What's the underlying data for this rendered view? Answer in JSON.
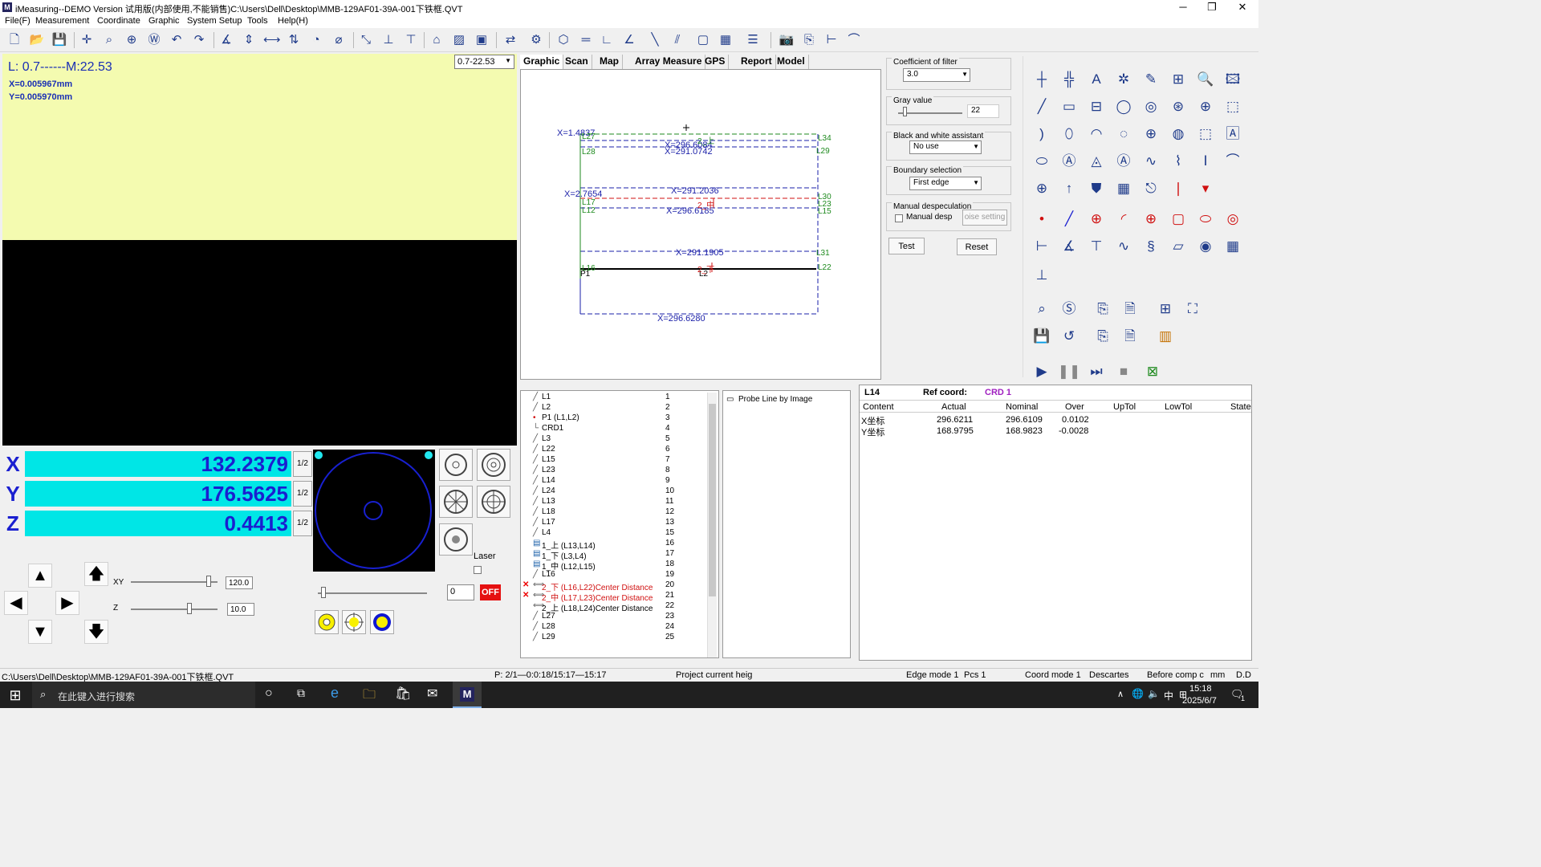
{
  "app": {
    "title": "iMeasuring--DEMO  Version  试用版(内部使用,不能销售)C:\\Users\\Dell\\Desktop\\MMB-129AF01-39A-001下铁框.QVT",
    "icon_letter": "M"
  },
  "menu": [
    "File(F)",
    "Measurement",
    "Coordinate",
    "Graphic",
    "System Setup",
    "Tools",
    "Help(H)"
  ],
  "camera": {
    "lm": "L: 0.7------M:22.53",
    "x": "X=0.005967mm",
    "y": "Y=0.005970mm",
    "zoom": "0.7-22.53"
  },
  "dro": {
    "x": {
      "axis": "X",
      "value": "132.2379",
      "half": "1/2"
    },
    "y": {
      "axis": "Y",
      "value": "176.5625",
      "half": "1/2"
    },
    "z": {
      "axis": "Z",
      "value": "0.4413",
      "half": "1/2"
    }
  },
  "jog": {
    "xy_label": "XY",
    "z_label": "Z",
    "xy_speed": "120.0",
    "z_speed": "10.0",
    "xy_level": 0.9,
    "z_level": 0.68
  },
  "lighting": {
    "laser_label": "Laser",
    "light_value": "0",
    "off_label": "OFF"
  },
  "tabs": [
    "Graphic",
    "Scan",
    "Map",
    "Array Measure",
    "GPS",
    "Report",
    "Model"
  ],
  "graphic": {
    "labels": {
      "x1": "X=1.4837",
      "x2": "X=296.6084",
      "x3": "X=291.0742",
      "x4": "X=2.7654",
      "x5": "X=291.2036",
      "x6": "X=296.6185",
      "x7": "X=291.1905",
      "x8": "X=296.6280",
      "l27": "L27",
      "l28": "L28",
      "l34": "L34",
      "l29": "L29",
      "l17": "L17",
      "l12": "L12",
      "l30": "L30",
      "l23": "L23",
      "l15": "L15",
      "l31": "L31",
      "l16": "L16",
      "p1": "P1",
      "l22": "L22",
      "l2": "L2",
      "m1": "2_上",
      "m2": "2_中",
      "m3": "2_下"
    }
  },
  "filters": {
    "coef_label": "Coefficient of filter",
    "coef_value": "3.0",
    "gray_label": "Gray value",
    "gray_value": "22",
    "bw_label": "Black and white assistant",
    "bw_value": "No use",
    "boundary_label": "Boundary selection",
    "boundary_value": "First edge",
    "manual_label": "Manual despeculation",
    "manual_check": "Manual desp",
    "noise_btn": "oise setting",
    "test_btn": "Test",
    "reset_btn": "Reset"
  },
  "tree": [
    {
      "name": "L1",
      "no": "1",
      "icon": "╱"
    },
    {
      "name": "L2",
      "no": "2",
      "icon": "╱"
    },
    {
      "name": "P1 (L1,L2)",
      "no": "3",
      "icon": "•"
    },
    {
      "name": "CRD1",
      "no": "4",
      "icon": "└"
    },
    {
      "name": "L3",
      "no": "5",
      "icon": "╱"
    },
    {
      "name": "L22",
      "no": "6",
      "icon": "╱"
    },
    {
      "name": "L15",
      "no": "7",
      "icon": "╱"
    },
    {
      "name": "L23",
      "no": "8",
      "icon": "╱"
    },
    {
      "name": "L14",
      "no": "9",
      "icon": "╱"
    },
    {
      "name": "L24",
      "no": "10",
      "icon": "╱"
    },
    {
      "name": "L13",
      "no": "11",
      "icon": "╱"
    },
    {
      "name": "L18",
      "no": "12",
      "icon": "╱"
    },
    {
      "name": "L17",
      "no": "13",
      "icon": "╱"
    },
    {
      "name": "L4",
      "no": "15",
      "icon": "╱"
    },
    {
      "name": "1_上 (L13,L14)",
      "no": "16",
      "icon": "▤"
    },
    {
      "name": "1_下 (L3,L4)",
      "no": "17",
      "icon": "▤"
    },
    {
      "name": "1_中 (L12,L15)",
      "no": "18",
      "icon": "▤"
    },
    {
      "name": "L16",
      "no": "19",
      "icon": "╱"
    },
    {
      "name": "2_下 (L16,L22)Center Distance",
      "no": "20",
      "icon": "⟺",
      "error": true
    },
    {
      "name": "2_中 (L17,L23)Center Distance",
      "no": "21",
      "icon": "⟺",
      "error": true
    },
    {
      "name": "2_上 (L18,L24)Center Distance",
      "no": "22",
      "icon": "⟺"
    },
    {
      "name": "L27",
      "no": "23",
      "icon": "╱"
    },
    {
      "name": "L28",
      "no": "24",
      "icon": "╱"
    },
    {
      "name": "L29",
      "no": "25",
      "icon": "╱"
    }
  ],
  "probe": {
    "label": "Probe Line by Image"
  },
  "result": {
    "element": "L14",
    "ref_label": "Ref coord:",
    "ref_value": "CRD 1",
    "headers": [
      "Content",
      "Actual",
      "Nominal",
      "Over",
      "UpTol",
      "LowTol",
      "State"
    ],
    "rows": [
      {
        "content": "X坐标",
        "actual": "296.6211",
        "nominal": "296.6109",
        "over": "0.0102"
      },
      {
        "content": "Y坐标",
        "actual": "168.9795",
        "nominal": "168.9823",
        "over": "-0.0028"
      }
    ]
  },
  "status": {
    "path": "C:\\Users\\Dell\\Desktop\\MMB-129AF01-39A-001下铁框.QVT",
    "progress": "P: 2/1—0:0:18/15:17—15:17",
    "project": "Project current heig",
    "edge": "Edge mode 1",
    "pcs": "Pcs 1",
    "coord": "Coord mode 1",
    "descartes": "Descartes",
    "comp": "Before comp c",
    "unit": "mm",
    "dd": "D.D"
  },
  "taskbar": {
    "search": "在此键入进行搜索",
    "time": "15:18",
    "date": "2025/6/7",
    "ime": "中",
    "notif": "1"
  },
  "colors": {
    "accent": "#1a1fd0",
    "dro_bg": "#00e6e6",
    "camera_light": "#f4fbb0",
    "dim_blue": "#1a1fa8",
    "dim_green": "#1e8a1e",
    "dim_red": "#d01010",
    "ref_purple": "#a020c0"
  }
}
